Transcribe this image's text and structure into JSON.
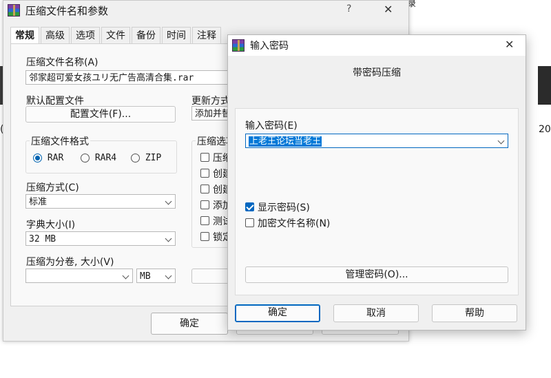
{
  "background_window": {
    "title": "压缩文件名和参数",
    "help_glyph": "?",
    "close_glyph": "✕",
    "tabs": [
      "常规",
      "高级",
      "选项",
      "文件",
      "备份",
      "时间",
      "注释"
    ],
    "archive_name_label": "压缩文件名称(A)",
    "archive_name_value": "邻家超可爱女孩ユリ无广告高清合集.rar",
    "default_profile_label": "默认配置文件",
    "profile_button": "配置文件(F)...",
    "update_mode_label": "更新方式",
    "update_mode_value": "添加并替",
    "format_group_label": "压缩文件格式",
    "formats": [
      {
        "label": "RAR",
        "selected": true
      },
      {
        "label": "RAR4",
        "selected": false
      },
      {
        "label": "ZIP",
        "selected": false
      }
    ],
    "options_group_label": "压缩选项",
    "option_items": [
      "压缩",
      "创建",
      "创建",
      "添加",
      "测试",
      "锁定"
    ],
    "method_label": "压缩方式(C)",
    "method_value": "标准",
    "dict_label": "字典大小(I)",
    "dict_value": "32 MB",
    "split_label": "压缩为分卷, 大小(V)",
    "split_value": "",
    "split_unit": "MB",
    "ok_button": "确定"
  },
  "dialog": {
    "title": "输入密码",
    "close_glyph": "✕",
    "header": "带密码压缩",
    "password_label": "输入密码(E)",
    "password_value": "上老王论坛当老王",
    "show_password_label": "显示密码(S)",
    "show_password_checked": true,
    "encrypt_names_label": "加密文件名称(N)",
    "encrypt_names_checked": false,
    "manage_button": "管理密码(O)...",
    "ok_button": "确定",
    "cancel_button": "取消",
    "help_button": "帮助"
  },
  "desktop": {
    "right_text_1": "20",
    "left_text_1": "(",
    "top_right_text": "录"
  },
  "colors": {
    "accent": "#0067c0",
    "selection": "#0078d7",
    "window_bg": "#f0f0f0"
  }
}
